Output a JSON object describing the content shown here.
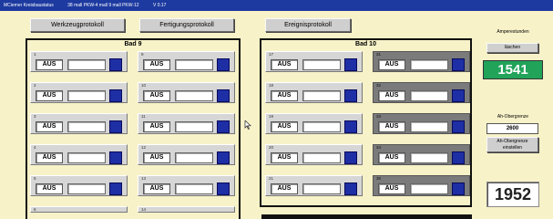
{
  "titlebar": {
    "parts": [
      "MCiemer Kreisbaustatus",
      "38 mall PKW-4 mall 9 mall PKW-12",
      "V 0.17"
    ]
  },
  "toolbar": {
    "werkzeug_label": "Werkzeugprotokoll",
    "fertigung_label": "Fertigungsprotokoll",
    "ereignis_label": "Ereignisprotokoll"
  },
  "bath9": {
    "title": "Bad 9",
    "slots": [
      {
        "num": "1",
        "status": "AUS",
        "dark": false
      },
      {
        "num": "9",
        "status": "AUS",
        "dark": false
      },
      {
        "num": "2",
        "status": "AUS",
        "dark": false
      },
      {
        "num": "10",
        "status": "AUS",
        "dark": false
      },
      {
        "num": "3",
        "status": "AUS",
        "dark": false
      },
      {
        "num": "11",
        "status": "AUS",
        "dark": false
      },
      {
        "num": "4",
        "status": "AUS",
        "dark": false
      },
      {
        "num": "12",
        "status": "AUS",
        "dark": false
      },
      {
        "num": "5",
        "status": "AUS",
        "dark": false
      },
      {
        "num": "13",
        "status": "AUS",
        "dark": false
      },
      {
        "num": "6",
        "status": "",
        "dark": false,
        "partial": true
      },
      {
        "num": "14",
        "status": "",
        "dark": false,
        "partial": true
      }
    ]
  },
  "bath10": {
    "title": "Bad 10",
    "slots": [
      {
        "num": "17",
        "status": "AUS",
        "dark": false
      },
      {
        "num": "31",
        "status": "AUS",
        "dark": true
      },
      {
        "num": "18",
        "status": "AUS",
        "dark": false
      },
      {
        "num": "32",
        "status": "AUS",
        "dark": true
      },
      {
        "num": "19",
        "status": "AUS",
        "dark": false
      },
      {
        "num": "33",
        "status": "AUS",
        "dark": true
      },
      {
        "num": "20",
        "status": "AUS",
        "dark": false
      },
      {
        "num": "34",
        "status": "AUS",
        "dark": true
      },
      {
        "num": "21",
        "status": "AUS",
        "dark": false
      },
      {
        "num": "35",
        "status": "AUS",
        "dark": true
      }
    ]
  },
  "side": {
    "amp_label": "Amperestunden",
    "amp_reset_label": "läschen",
    "amp_value": "1541",
    "limit_label": "Ah-Obergrenze",
    "limit_value": "2600",
    "limit_button_label": "Ah-Obergrenze einstellen",
    "counter_value": "1952"
  },
  "colors": {
    "indicator": "#1e2fa5",
    "amp_bg": "#22a35a",
    "panel_bg": "#f7f2c8",
    "titlebar": "#1d3aa0"
  },
  "icons": {
    "cursor": "mouse-pointer-icon"
  }
}
